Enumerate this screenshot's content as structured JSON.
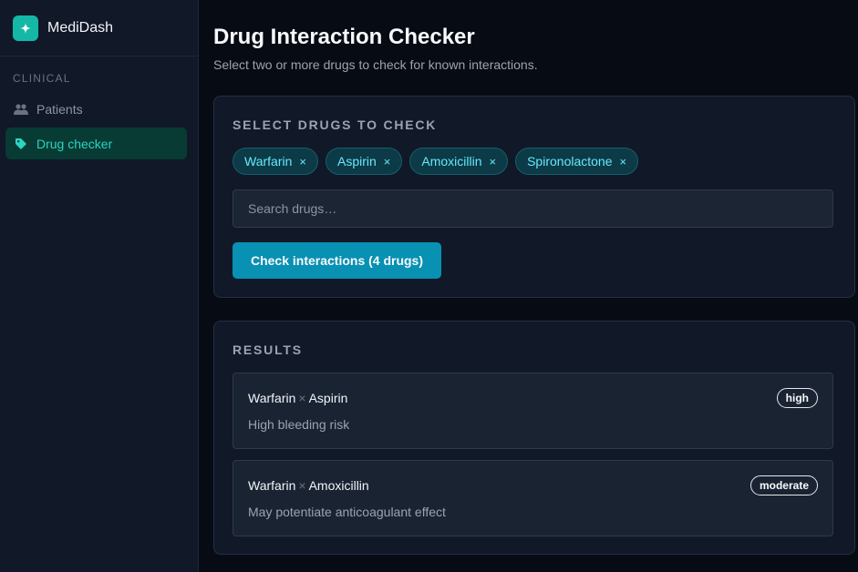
{
  "app": {
    "name": "MediDash"
  },
  "sidebar": {
    "section": "CLINICAL",
    "items": [
      {
        "label": "Patients",
        "icon": "users-icon",
        "active": false
      },
      {
        "label": "Drug checker",
        "icon": "tag-icon",
        "active": true
      }
    ]
  },
  "page": {
    "title": "Drug Interaction Checker",
    "subtitle": "Select two or more drugs to check for known interactions."
  },
  "selector": {
    "heading": "SELECT DRUGS TO CHECK",
    "chips": [
      "Warfarin",
      "Aspirin",
      "Amoxicillin",
      "Spironolactone"
    ],
    "remove_glyph": "×",
    "search_placeholder": "Search drugs…",
    "search_value": "",
    "check_button": "Check interactions (4 drugs)"
  },
  "results": {
    "heading": "RESULTS",
    "separator": "×",
    "items": [
      {
        "drug_a": "Warfarin",
        "drug_b": "Aspirin",
        "description": "High bleeding risk",
        "severity": "high"
      },
      {
        "drug_a": "Warfarin",
        "drug_b": "Amoxicillin",
        "description": "May potentiate anticoagulant effect",
        "severity": "moderate"
      }
    ]
  },
  "colors": {
    "accent": "#14b8a6",
    "button": "#0891b2",
    "background": "#070b14",
    "card": "#111827"
  }
}
